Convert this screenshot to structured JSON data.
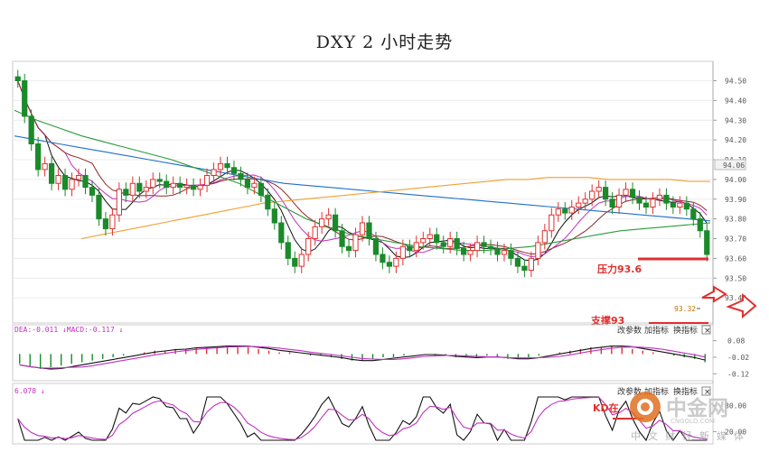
{
  "title": "DXY 2 小时走势",
  "chart_data": {
    "type": "candlestick",
    "symbol": "DXY",
    "timeframe": "2 小时",
    "ylim": [
      93.3,
      94.58
    ],
    "y_ticks": [
      "94.50",
      "94.40",
      "94.30",
      "94.20",
      "94.10",
      "94.00",
      "93.90",
      "93.80",
      "93.70",
      "93.60",
      "93.50",
      "93.40"
    ],
    "last_price_label": "94.06",
    "last_price": 94.06,
    "low_marker_label": "93.32",
    "low_marker": 93.32,
    "closes": [
      94.5,
      94.32,
      94.18,
      94.05,
      94.08,
      93.98,
      94.02,
      93.95,
      94.0,
      94.02,
      93.96,
      93.92,
      93.8,
      93.75,
      93.82,
      93.95,
      93.92,
      93.98,
      93.94,
      93.96,
      94.0,
      93.99,
      93.96,
      93.98,
      93.96,
      93.97,
      93.95,
      93.97,
      94.02,
      94.05,
      94.08,
      94.06,
      94.03,
      94.0,
      93.96,
      93.98,
      93.92,
      93.85,
      93.78,
      93.68,
      93.6,
      93.56,
      93.62,
      93.7,
      93.76,
      93.8,
      93.82,
      93.74,
      93.66,
      93.64,
      93.72,
      93.78,
      93.7,
      93.62,
      93.58,
      93.56,
      93.6,
      93.66,
      93.64,
      93.68,
      93.7,
      93.72,
      93.68,
      93.66,
      93.7,
      93.65,
      93.62,
      93.64,
      93.68,
      93.66,
      93.65,
      93.62,
      93.64,
      93.6,
      93.56,
      93.54,
      93.6,
      93.68,
      93.74,
      93.82,
      93.85,
      93.83,
      93.86,
      93.88,
      93.9,
      93.94,
      93.96,
      93.9,
      93.86,
      93.92,
      93.95,
      93.91,
      93.88,
      93.86,
      93.9,
      93.92,
      93.88,
      93.86,
      93.88,
      93.85,
      93.8,
      93.74,
      93.62
    ],
    "moving_averages": [
      {
        "color": "#1f6fc7",
        "values": [
          94.22,
          94.2,
          94.18,
          94.16,
          94.14,
          94.12,
          94.1,
          94.08,
          94.06,
          94.04,
          94.02,
          94.0,
          93.98,
          93.97,
          93.96,
          93.95,
          93.94,
          93.93,
          93.92,
          93.91,
          93.9,
          93.89,
          93.88,
          93.87,
          93.86,
          93.85,
          93.84,
          93.83,
          93.82,
          93.81,
          93.8,
          93.79
        ]
      },
      {
        "color": "#f0a030",
        "values": [
          93.7,
          93.72,
          93.74,
          93.76,
          93.78,
          93.8,
          93.82,
          93.84,
          93.86,
          93.88,
          93.89,
          93.9,
          93.91,
          93.92,
          93.93,
          93.94,
          93.95,
          93.96,
          93.97,
          93.98,
          93.99,
          94.0,
          94.0,
          94.01,
          94.01,
          94.01,
          94.0,
          94.0,
          94.0,
          94.0,
          93.99,
          93.99
        ]
      },
      {
        "color": "#2a9a3a",
        "values": [
          94.35,
          94.3,
          94.26,
          94.22,
          94.19,
          94.16,
          94.13,
          94.1,
          94.06,
          94.02,
          93.98,
          93.92,
          93.86,
          93.8,
          93.76,
          93.72,
          93.7,
          93.68,
          93.66,
          93.65,
          93.64,
          93.64,
          93.65,
          93.66,
          93.68,
          93.7,
          93.72,
          93.74,
          93.75,
          93.76,
          93.77,
          93.78
        ]
      }
    ],
    "annotations": [
      {
        "text": "压力93.6",
        "color": "#e03030"
      },
      {
        "text": "支撑93",
        "color": "#e03030"
      }
    ],
    "macd": {
      "label": "DEA:-0.011 ↓MACD:-0.117 ↓",
      "ylim": [
        -0.14,
        0.1
      ],
      "y_ticks": [
        "0.08",
        "-0.02",
        "-0.12"
      ],
      "hist": [
        -0.06,
        -0.08,
        -0.09,
        -0.08,
        -0.07,
        -0.06,
        -0.05,
        -0.04,
        -0.03,
        -0.02,
        -0.01,
        0.0,
        0.01,
        0.02,
        0.02,
        0.03,
        0.03,
        0.04,
        0.04,
        0.04,
        0.05,
        0.04,
        0.04,
        0.03,
        0.02,
        0.01,
        0.01,
        0.0,
        -0.01,
        -0.01,
        -0.02,
        -0.03,
        -0.04,
        -0.04,
        -0.03,
        -0.02,
        -0.02,
        -0.01,
        0.0,
        0.0,
        -0.01,
        -0.01,
        -0.02,
        -0.02,
        -0.02,
        -0.01,
        -0.02,
        -0.03,
        -0.03,
        -0.02,
        -0.01,
        0.0,
        0.01,
        0.02,
        0.03,
        0.04,
        0.04,
        0.05,
        0.04,
        0.03,
        0.02,
        0.01,
        0.0,
        -0.01,
        -0.02,
        -0.03,
        -0.05
      ]
    },
    "kd": {
      "label": "6.078 ↓",
      "ylim": [
        0,
        100
      ],
      "y_ticks": [
        "80.00",
        "20.00"
      ]
    }
  },
  "buttons": {
    "params": "改参数",
    "add_indicator": "加指标",
    "switch_indicator": "换指标",
    "close": "×"
  },
  "watermark": {
    "brand": "中金网",
    "domain": "CNGOLD.COM",
    "slogan": "中文财经新媒体",
    "kd_obscured": "KD在"
  },
  "colors": {
    "up": "#e03030",
    "down": "#1a8a2a",
    "annotation": "#e03030",
    "macd_dif": "#111111",
    "macd_dea": "#c030c0"
  }
}
